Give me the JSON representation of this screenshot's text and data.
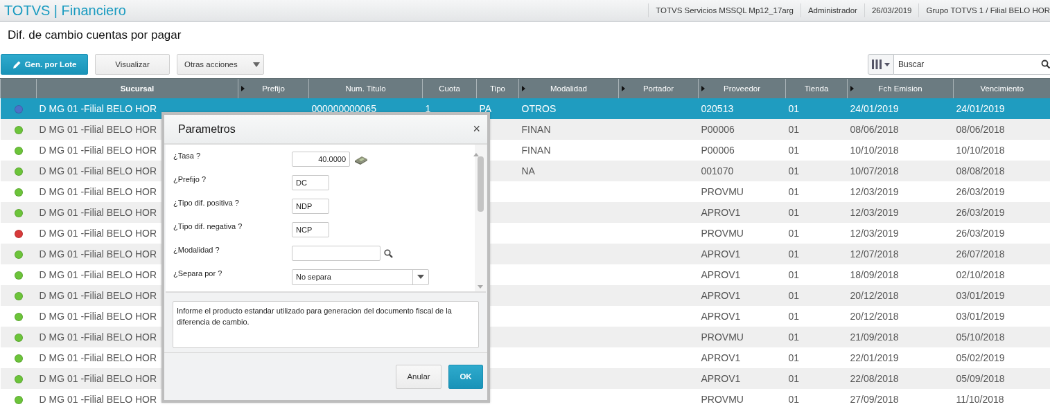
{
  "app_bar": {
    "title": "TOTVS | Financiero",
    "info": [
      "TOTVS Servicios MSSQL Mp12_17arg",
      "Administrador",
      "26/03/2019",
      "Grupo TOTVS 1 / Filial BELO HOR"
    ]
  },
  "page_title": "Dif. de cambio cuentas por pagar",
  "toolbar": {
    "buttons": [
      {
        "label": "Gen. por Lote",
        "kind": "primary"
      },
      {
        "label": "Visualizar",
        "kind": "default"
      },
      {
        "label": "Otras acciones",
        "kind": "dropdown"
      }
    ],
    "search": {
      "placeholder": "Buscar"
    }
  },
  "table": {
    "columns": [
      {
        "label": "Sucursal",
        "menu": false
      },
      {
        "label": "Prefijo",
        "menu": true
      },
      {
        "label": "Num. Titulo",
        "menu": false
      },
      {
        "label": "Cuota",
        "menu": false
      },
      {
        "label": "Tipo",
        "menu": false
      },
      {
        "label": "Modalidad",
        "menu": true
      },
      {
        "label": "Portador",
        "menu": true
      },
      {
        "label": "Proveedor",
        "menu": true
      },
      {
        "label": "Tienda",
        "menu": false
      },
      {
        "label": "Fch Emision",
        "menu": true
      },
      {
        "label": "Vencimiento",
        "menu": false
      }
    ],
    "rows": [
      {
        "selected": true,
        "color": "#4a72c8",
        "sucursal": "D MG 01 -Filial BELO HOR",
        "num_titulo": "000000000065",
        "cuota": "1",
        "tipo": "PA",
        "modalidad": "OTROS",
        "proveedor": "020513",
        "tienda": "01",
        "fch_emision": "24/01/2019",
        "vencimiento": "24/01/2019"
      },
      {
        "selected": false,
        "color": "#6cc43a",
        "sucursal": "D MG 01 -Filial BELO HOR",
        "modalidad": "FINAN",
        "proveedor": "P00006",
        "tienda": "01",
        "fch_emision": "08/06/2018",
        "vencimiento": "08/06/2018"
      },
      {
        "selected": false,
        "color": "#6cc43a",
        "sucursal": "D MG 01 -Filial BELO HOR",
        "modalidad": "FINAN",
        "proveedor": "P00006",
        "tienda": "01",
        "fch_emision": "10/10/2018",
        "vencimiento": "10/10/2018"
      },
      {
        "selected": false,
        "color": "#6cc43a",
        "sucursal": "D MG 01 -Filial BELO HOR",
        "modalidad": "NA",
        "proveedor": "001070",
        "tienda": "01",
        "fch_emision": "10/07/2018",
        "vencimiento": "08/08/2018"
      },
      {
        "selected": false,
        "color": "#6cc43a",
        "sucursal": "D MG 01 -Filial BELO HOR",
        "proveedor": "PROVMU",
        "tienda": "01",
        "fch_emision": "12/03/2019",
        "vencimiento": "26/03/2019"
      },
      {
        "selected": false,
        "color": "#6cc43a",
        "sucursal": "D MG 01 -Filial BELO HOR",
        "proveedor": "APROV1",
        "tienda": "01",
        "fch_emision": "12/03/2019",
        "vencimiento": "26/03/2019"
      },
      {
        "selected": false,
        "color": "#d83a3a",
        "sucursal": "D MG 01 -Filial BELO HOR",
        "proveedor": "PROVMU",
        "tienda": "01",
        "fch_emision": "12/03/2019",
        "vencimiento": "26/03/2019"
      },
      {
        "selected": false,
        "color": "#6cc43a",
        "sucursal": "D MG 01 -Filial BELO HOR",
        "proveedor": "APROV1",
        "tienda": "01",
        "fch_emision": "12/07/2018",
        "vencimiento": "26/07/2018"
      },
      {
        "selected": false,
        "color": "#6cc43a",
        "sucursal": "D MG 01 -Filial BELO HOR",
        "proveedor": "APROV1",
        "tienda": "01",
        "fch_emision": "18/09/2018",
        "vencimiento": "02/10/2018"
      },
      {
        "selected": false,
        "color": "#6cc43a",
        "sucursal": "D MG 01 -Filial BELO HOR",
        "proveedor": "APROV1",
        "tienda": "01",
        "fch_emision": "20/12/2018",
        "vencimiento": "03/01/2019"
      },
      {
        "selected": false,
        "color": "#6cc43a",
        "sucursal": "D MG 01 -Filial BELO HOR",
        "proveedor": "APROV1",
        "tienda": "01",
        "fch_emision": "20/12/2018",
        "vencimiento": "03/01/2019"
      },
      {
        "selected": false,
        "color": "#6cc43a",
        "sucursal": "D MG 01 -Filial BELO HOR",
        "proveedor": "PROVMU",
        "tienda": "01",
        "fch_emision": "21/09/2018",
        "vencimiento": "05/10/2018"
      },
      {
        "selected": false,
        "color": "#6cc43a",
        "sucursal": "D MG 01 -Filial BELO HOR",
        "proveedor": "APROV1",
        "tienda": "01",
        "fch_emision": "22/01/2019",
        "vencimiento": "05/02/2019"
      },
      {
        "selected": false,
        "color": "#6cc43a",
        "sucursal": "D MG 01 -Filial BELO HOR",
        "proveedor": "APROV1",
        "tienda": "01",
        "fch_emision": "22/08/2018",
        "vencimiento": "05/09/2018"
      },
      {
        "selected": false,
        "color": "#6cc43a",
        "sucursal": "D MG 01 -Filial BELO HOR",
        "proveedor": "PROVMU",
        "tienda": "01",
        "fch_emision": "27/09/2018",
        "vencimiento": "11/10/2018"
      }
    ]
  },
  "dialog": {
    "title": "Parametros",
    "close": "×",
    "fields": [
      {
        "label": "¿Tasa ?",
        "value": "40.0000",
        "kind": "calc"
      },
      {
        "label": "¿Prefijo ?",
        "value": "DC",
        "kind": "text"
      },
      {
        "label": "¿Tipo dif. positiva ?",
        "value": "NDP",
        "kind": "text"
      },
      {
        "label": "¿Tipo dif. negativa ?",
        "value": "NCP",
        "kind": "text"
      },
      {
        "label": "¿Modalidad ?",
        "kind": "lookup"
      },
      {
        "label": "¿Separa por ?",
        "value": "No separa",
        "kind": "select"
      }
    ],
    "help": "Informe el producto estandar utilizado para generacion del documento fiscal de la diferencia de cambio.",
    "buttons": [
      {
        "label": "Anular",
        "kind": "default"
      },
      {
        "label": "OK",
        "kind": "primary"
      }
    ]
  }
}
